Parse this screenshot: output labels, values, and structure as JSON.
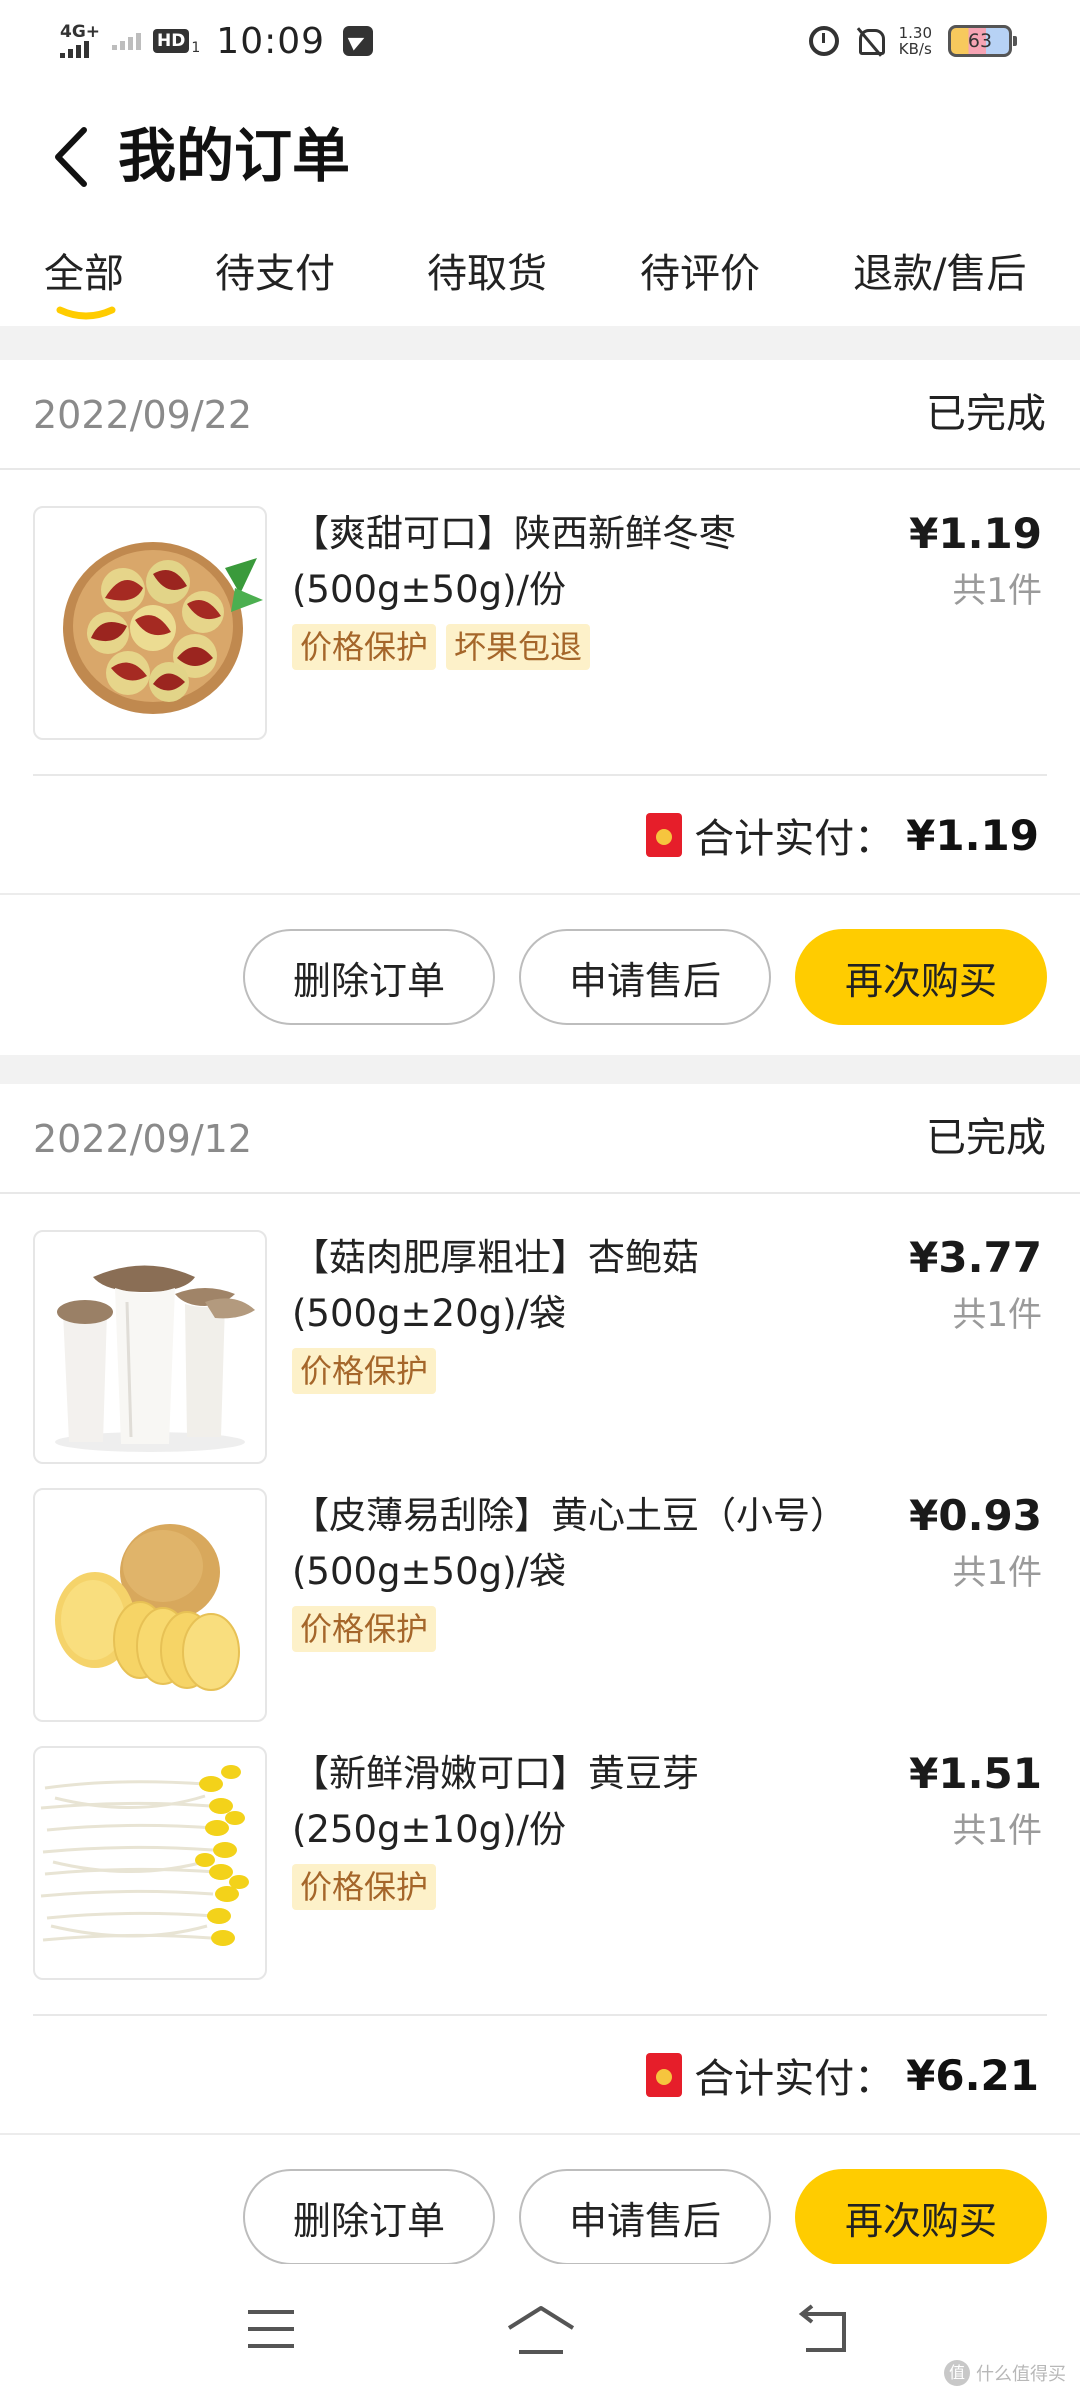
{
  "status_bar": {
    "network": "4G+",
    "hd": "HD",
    "sim": "1",
    "time": "10:09",
    "speed_value": "1.30",
    "speed_unit": "KB/s",
    "battery": "63"
  },
  "header": {
    "title": "我的订单"
  },
  "tabs": [
    {
      "label": "全部",
      "active": true
    },
    {
      "label": "待支付"
    },
    {
      "label": "待取货"
    },
    {
      "label": "待评价"
    },
    {
      "label": "退款/售后"
    }
  ],
  "orders": [
    {
      "date": "2022/09/22",
      "status": "已完成",
      "items": [
        {
          "name": "【爽甜可口】陕西新鲜冬枣(500g±50g)/份",
          "badges": [
            "价格保护",
            "坏果包退"
          ],
          "price": "¥1.19",
          "qty": "共1件",
          "image": "winter-jujube"
        }
      ],
      "total_label": "合计实付：",
      "total": "¥1.19",
      "buttons": {
        "delete": "删除订单",
        "after_sale": "申请售后",
        "rebuy": "再次购买"
      }
    },
    {
      "date": "2022/09/12",
      "status": "已完成",
      "items": [
        {
          "name": "【菇肉肥厚粗壮】杏鲍菇(500g±20g)/袋",
          "badges": [
            "价格保护"
          ],
          "price": "¥3.77",
          "qty": "共1件",
          "image": "king-oyster-mushroom"
        },
        {
          "name": "【皮薄易刮除】黄心土豆（小号）(500g±50g)/袋",
          "badges": [
            "价格保护"
          ],
          "price": "¥0.93",
          "qty": "共1件",
          "image": "potato"
        },
        {
          "name": "【新鲜滑嫩可口】黄豆芽(250g±10g)/份",
          "badges": [
            "价格保护"
          ],
          "price": "¥1.51",
          "qty": "共1件",
          "image": "soybean-sprouts"
        }
      ],
      "total_label": "合计实付：",
      "total": "¥6.21",
      "buttons": {
        "delete": "删除订单",
        "after_sale": "申请售后",
        "rebuy": "再次购买"
      }
    }
  ],
  "navbar": {
    "icons": [
      "menu-icon",
      "home-icon",
      "back-icon"
    ]
  },
  "watermark": {
    "text": "什么值得买",
    "mark": "值"
  },
  "colors": {
    "accent": "#ffcc00",
    "badge_bg": "#fdf1c9",
    "badge_text": "#a5662a"
  }
}
